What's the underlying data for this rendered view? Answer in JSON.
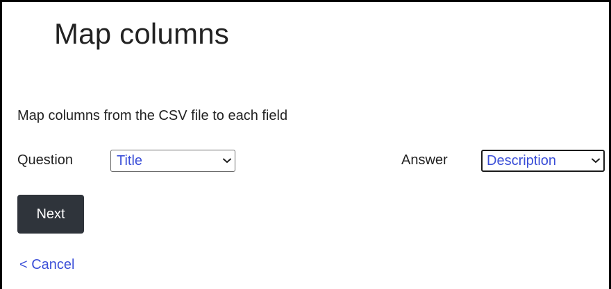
{
  "page": {
    "title": "Map columns",
    "subtitle": "Map columns from the CSV file to each field"
  },
  "fields": {
    "question": {
      "label": "Question",
      "selected": "Title"
    },
    "answer": {
      "label": "Answer",
      "selected": "Description"
    }
  },
  "actions": {
    "next_label": "Next",
    "cancel_label": "< Cancel"
  },
  "icons": {
    "dropdown": "chevron-down-icon"
  },
  "colors": {
    "link": "#3b4fd8",
    "button_bg": "#2f343b",
    "button_text": "#ffffff",
    "text": "#222222"
  }
}
